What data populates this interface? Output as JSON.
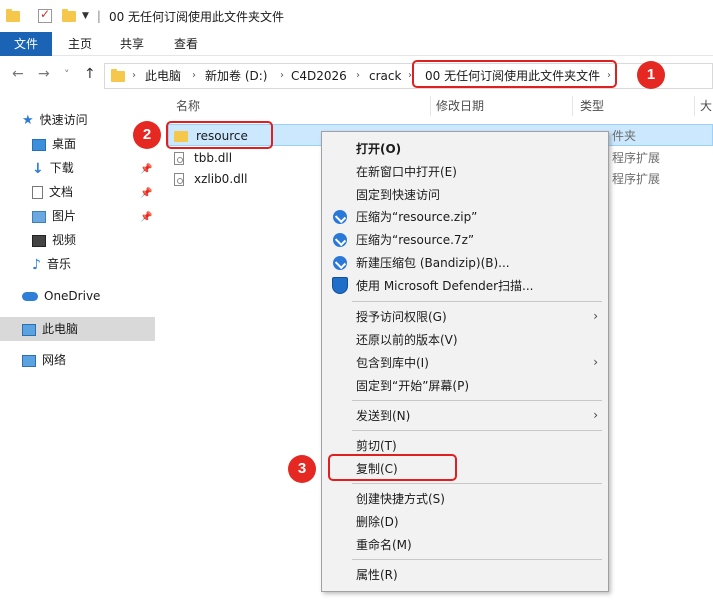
{
  "title_bar": {
    "title": "00 无任何订阅使用此文件夹文件",
    "separator": "|"
  },
  "ribbon": {
    "tabs": [
      {
        "label": "文件"
      },
      {
        "label": "主页"
      },
      {
        "label": "共享"
      },
      {
        "label": "查看"
      }
    ]
  },
  "nav_buttons": {
    "back": "←",
    "forward": "→",
    "recent": "˅",
    "up": "↑"
  },
  "address_bar": {
    "crumbs": [
      "此电脑",
      "新加卷 (D:)",
      "C4D2026",
      "crack",
      "00 无任何订阅使用此文件夹文件"
    ]
  },
  "nav_pane": {
    "quick_access": "快速访问",
    "items": [
      {
        "label": "桌面",
        "icon": "desktop-icon",
        "pinned": true
      },
      {
        "label": "下载",
        "icon": "download-icon",
        "pinned": true
      },
      {
        "label": "文档",
        "icon": "documents-icon",
        "pinned": true
      },
      {
        "label": "图片",
        "icon": "pictures-icon",
        "pinned": true
      },
      {
        "label": "视频",
        "icon": "videos-icon",
        "pinned": false
      },
      {
        "label": "音乐",
        "icon": "music-icon",
        "pinned": false
      }
    ],
    "onedrive": "OneDrive",
    "this_pc": "此电脑",
    "network": "网络"
  },
  "file_list": {
    "columns": [
      "名称",
      "修改日期",
      "类型",
      "大"
    ],
    "rows": [
      {
        "name": "resource",
        "type": "文件夹",
        "icon": "folder-icon"
      },
      {
        "name": "tbb.dll",
        "type": "应用程序扩展",
        "icon": "dll-file-icon"
      },
      {
        "name": "xzlib0.dll",
        "type": "应用程序扩展",
        "icon": "dll-file-icon"
      }
    ],
    "visible_type_fragments": [
      "件夹",
      "程序扩展",
      "程序扩展"
    ]
  },
  "context_menu": {
    "items": [
      {
        "label": "打开(O)",
        "bold": true
      },
      {
        "label": "在新窗口中打开(E)"
      },
      {
        "label": "固定到快速访问"
      },
      {
        "label": "压缩为“resource.zip”",
        "icon": "bandizip-icon"
      },
      {
        "label": "压缩为“resource.7z”",
        "icon": "bandizip-icon"
      },
      {
        "label": "新建压缩包 (Bandizip)(B)...",
        "icon": "bandizip-icon"
      },
      {
        "label": "使用 Microsoft Defender扫描...",
        "icon": "defender-shield-icon"
      },
      {
        "label": "授予访问权限(G)",
        "submenu": true
      },
      {
        "label": "还原以前的版本(V)"
      },
      {
        "label": "包含到库中(I)",
        "submenu": true
      },
      {
        "label": "固定到“开始”屏幕(P)"
      },
      {
        "label": "发送到(N)",
        "submenu": true
      },
      {
        "label": "剪切(T)"
      },
      {
        "label": "复制(C)"
      },
      {
        "label": "创建快捷方式(S)"
      },
      {
        "label": "删除(D)"
      },
      {
        "label": "重命名(M)"
      },
      {
        "label": "属性(R)"
      }
    ],
    "submenu_arrow": "›"
  },
  "callouts": [
    {
      "number": "1"
    },
    {
      "number": "2"
    },
    {
      "number": "3"
    }
  ],
  "colors": {
    "ribbon_file_tab": "#1a63b5",
    "selection": "#cce8ff",
    "callout_red": "#e52822",
    "folder_yellow": "#f5c84c"
  }
}
